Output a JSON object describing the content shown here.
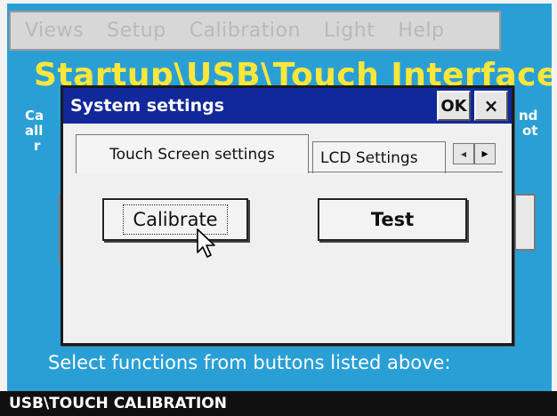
{
  "menu": {
    "items": [
      "Views",
      "Setup",
      "Calibration",
      "Light",
      "Help"
    ]
  },
  "background": {
    "title": "Startup\\USB\\Touch Interface",
    "left_fragments": [
      "Ca",
      "all",
      "r"
    ],
    "right_fragments": [
      "nd",
      "ot"
    ],
    "hint": "Select functions from buttons listed above:"
  },
  "dialog": {
    "title": "System settings",
    "ok_label": "OK",
    "close_label": "×",
    "tabs": [
      {
        "label": "Touch Screen settings",
        "selected": true
      },
      {
        "label": "LCD Settings",
        "selected": false
      }
    ],
    "tab_scroll_left": "◂",
    "tab_scroll_right": "▸",
    "buttons": {
      "calibrate": "Calibrate",
      "test": "Test"
    }
  },
  "statusbar": {
    "text": "USB\\TOUCH CALIBRATION"
  },
  "colors": {
    "screen_bg": "#2a9fd6",
    "title_yellow": "#ffe63a",
    "titlebar": "#11289a"
  }
}
